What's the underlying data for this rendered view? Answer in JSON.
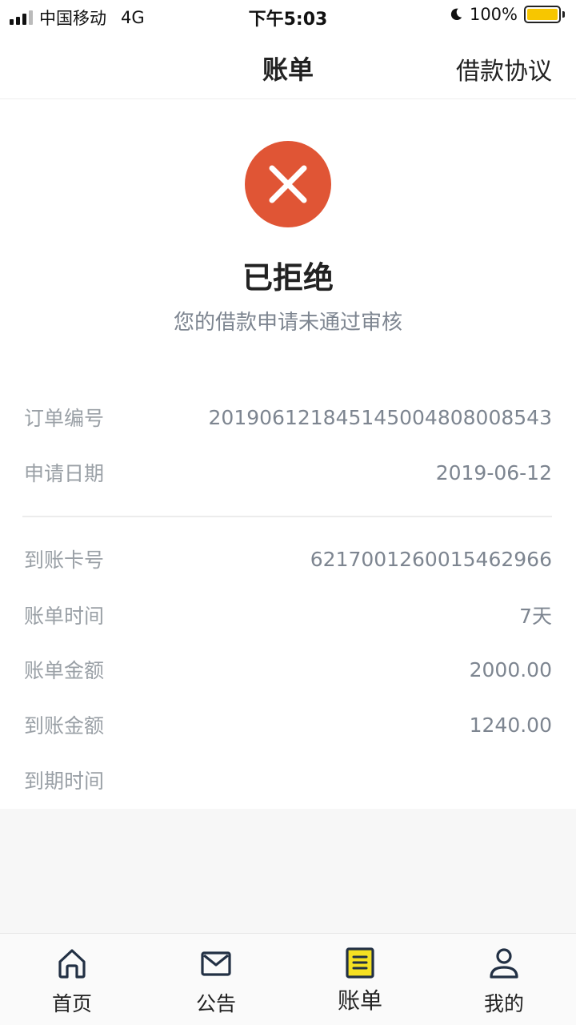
{
  "status_bar": {
    "carrier": "中国移动",
    "network": "4G",
    "time": "下午5:03",
    "battery": "100%"
  },
  "nav": {
    "title": "账单",
    "right_label": "借款协议"
  },
  "result": {
    "title": "已拒绝",
    "subtitle": "您的借款申请未通过审核",
    "icon_color": "#e05535"
  },
  "order": {
    "rows": [
      {
        "label": "订单编号",
        "value": "2019061218451450048080085​43"
      },
      {
        "label": "申请日期",
        "value": "2019-06-12"
      }
    ]
  },
  "details": {
    "rows": [
      {
        "label": "到账卡号",
        "value": "6217001260015462966"
      },
      {
        "label": "账单时间",
        "value": "7天"
      },
      {
        "label": "账单金额",
        "value": "2000.00"
      },
      {
        "label": "到账金额",
        "value": "1240.00"
      },
      {
        "label": "到期时间",
        "value": ""
      }
    ]
  },
  "tabs": [
    {
      "label": "首页",
      "icon": "home-icon"
    },
    {
      "label": "公告",
      "icon": "mail-icon"
    },
    {
      "label": "账单",
      "icon": "bill-icon",
      "active": true
    },
    {
      "label": "我的",
      "icon": "user-icon"
    }
  ],
  "colors": {
    "accent": "#f5e022",
    "reject": "#e05535"
  }
}
